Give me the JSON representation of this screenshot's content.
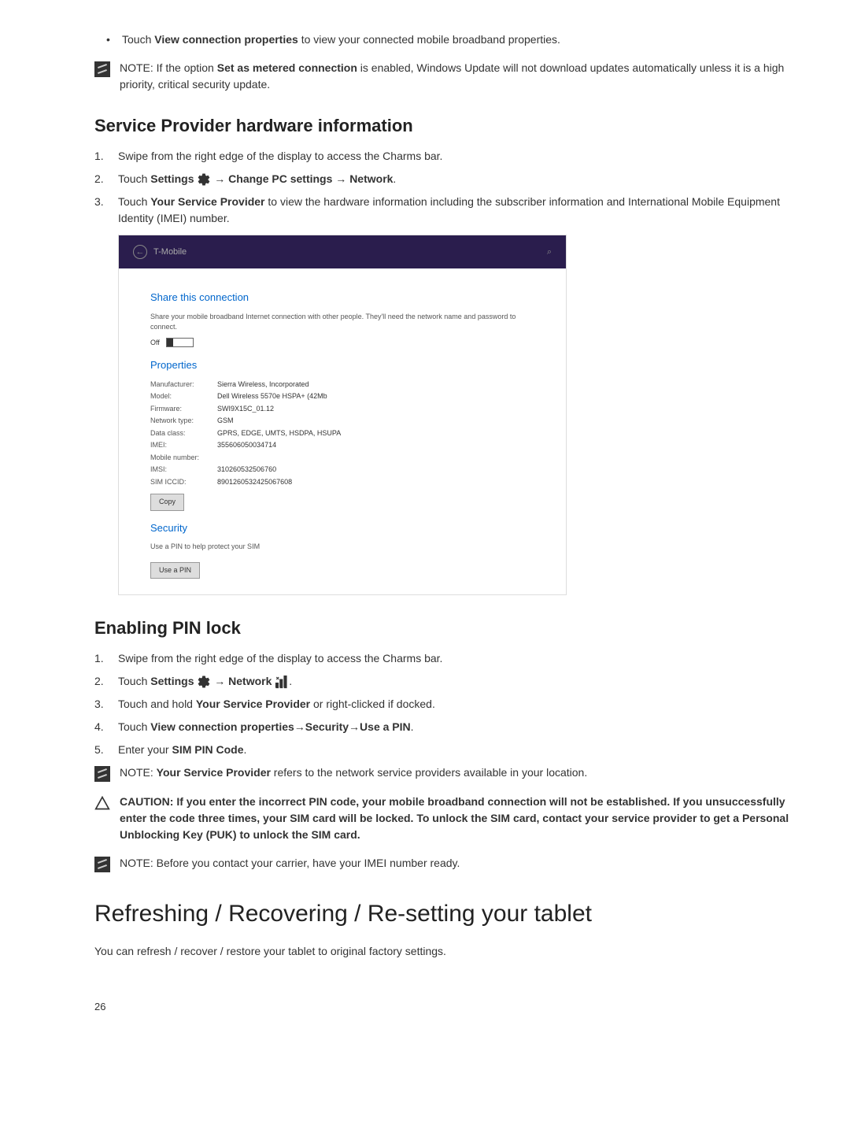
{
  "intro_bullet": {
    "prefix": "Touch ",
    "bold": "View connection properties",
    "suffix": " to view your connected mobile broadband properties."
  },
  "note1": {
    "label": "NOTE: ",
    "p1": "If the option ",
    "bold": "Set as metered connection",
    "p2": " is enabled, Windows Update will not download updates automatically unless it is a high priority, critical security update."
  },
  "section1_title": "Service Provider hardware information",
  "section1_steps": {
    "s1": "Swipe from the right edge of the display to access the Charms bar.",
    "s2_p1": "Touch ",
    "s2_b1": "Settings ",
    "s2_p2": " → ",
    "s2_b2": "Change PC settings",
    "s2_p3": " → ",
    "s2_b3": "Network",
    "s2_p4": ".",
    "s3_p1": "Touch ",
    "s3_b1": "Your Service Provider",
    "s3_p2": " to view the hardware information including the subscriber information and International Mobile Equipment Identity (IMEI) number."
  },
  "screenshot": {
    "title": "T-Mobile",
    "share_title": "Share this connection",
    "share_desc": "Share your mobile broadband Internet connection with other people. They'll need the network name and password to connect.",
    "toggle_label": "Off",
    "properties_title": "Properties",
    "props": {
      "manufacturer_k": "Manufacturer:",
      "manufacturer_v": "Sierra Wireless, Incorporated",
      "model_k": "Model:",
      "model_v": "Dell Wireless 5570e HSPA+ (42Mb",
      "firmware_k": "Firmware:",
      "firmware_v": "SWI9X15C_01.12",
      "network_type_k": "Network type:",
      "network_type_v": "GSM",
      "data_class_k": "Data class:",
      "data_class_v": "GPRS, EDGE, UMTS, HSDPA, HSUPA",
      "imei_k": "IMEI:",
      "imei_v": "355606050034714",
      "mobile_num_k": "Mobile number:",
      "mobile_num_v": "",
      "imsi_k": "IMSI:",
      "imsi_v": "310260532506760",
      "sim_iccid_k": "SIM ICCID:",
      "sim_iccid_v": "8901260532425067608"
    },
    "copy_btn": "Copy",
    "security_title": "Security",
    "security_desc": "Use a PIN to help protect your SIM",
    "use_pin_btn": "Use a PIN"
  },
  "section2_title": "Enabling PIN lock",
  "section2_steps": {
    "s1": "Swipe from the right edge of the display to access the Charms bar.",
    "s2_p1": "Touch ",
    "s2_b1": "Settings ",
    "s2_p2": " → ",
    "s2_b2": "Network ",
    "s2_p3": ".",
    "s3_p1": "Touch and hold ",
    "s3_b1": "Your Service Provider",
    "s3_p2": " or right-clicked if docked.",
    "s4_p1": "Touch ",
    "s4_b1": "View connection properties→Security→Use a PIN",
    "s4_p2": ".",
    "s5_p1": "Enter your ",
    "s5_b1": "SIM PIN Code",
    "s5_p2": "."
  },
  "note2": {
    "label": "NOTE: ",
    "bold": "Your Service Provider",
    "suffix": " refers to the network service providers available in your location."
  },
  "caution": {
    "label": "CAUTION: ",
    "text": "If you enter the incorrect PIN code, your mobile broadband connection will not be established. If you unsuccessfully enter the code three times, your SIM card will be locked. To unlock the SIM card, contact your service provider to get a Personal Unblocking Key (PUK) to unlock the SIM card."
  },
  "note3": {
    "label": "NOTE: ",
    "text": "Before you contact your carrier, have your IMEI number ready."
  },
  "main_heading": "Refreshing / Recovering / Re-setting your tablet",
  "main_body": "You can refresh / recover / restore your tablet to original factory settings.",
  "page_num": "26"
}
